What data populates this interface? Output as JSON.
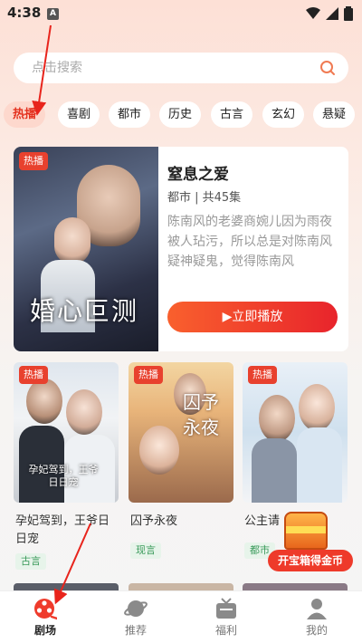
{
  "status_bar": {
    "time": "4:38",
    "notification_letter": "A"
  },
  "search": {
    "placeholder": "点击搜索"
  },
  "categories": [
    {
      "label": "热播",
      "active": true
    },
    {
      "label": "喜剧",
      "active": false
    },
    {
      "label": "都市",
      "active": false
    },
    {
      "label": "历史",
      "active": false
    },
    {
      "label": "古言",
      "active": false
    },
    {
      "label": "玄幻",
      "active": false
    },
    {
      "label": "悬疑",
      "active": false
    }
  ],
  "featured": {
    "badge": "热播",
    "poster_title": "婚心叵测",
    "title": "窒息之爱",
    "meta": "都市 | 共45集",
    "description": "陈南风的老婆商婉儿因为雨夜被人玷污，所以总是对陈南风疑神疑鬼，觉得陈南风",
    "play_label": "▶立即播放"
  },
  "cards": [
    {
      "badge": "热播",
      "poster_caption": "孕妃驾到，王爷日日宠",
      "title": "孕妃驾到，王爷日日宠",
      "tag": "古言"
    },
    {
      "badge": "热播",
      "poster_caption": "囚予永夜",
      "title": "囚予永夜",
      "tag": "现言"
    },
    {
      "badge": "热播",
      "poster_caption": "",
      "title": "公主请",
      "tag": "都市"
    }
  ],
  "treasure": {
    "label": "开宝箱得金币"
  },
  "tabs": [
    {
      "label": "剧场",
      "icon": "film-reel-icon",
      "active": true
    },
    {
      "label": "推荐",
      "icon": "planet-icon",
      "active": false
    },
    {
      "label": "福利",
      "icon": "tv-gift-icon",
      "active": false
    },
    {
      "label": "我的",
      "icon": "user-icon",
      "active": false
    }
  ],
  "colors": {
    "accent": "#e8412e",
    "play_gradient_start": "#f9602d",
    "play_gradient_end": "#e8242c"
  }
}
